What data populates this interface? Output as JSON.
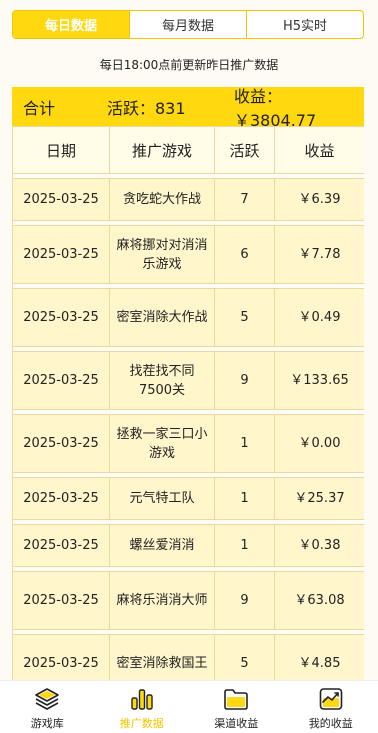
{
  "tabs": [
    {
      "label": "每日数据",
      "active": true
    },
    {
      "label": "每月数据",
      "active": false
    },
    {
      "label": "H5实时",
      "active": false
    }
  ],
  "notice": "每日18:00点前更新昨日推广数据",
  "summary": {
    "label": "合计",
    "active": "活跃：831",
    "income": "收益：￥3804.77"
  },
  "table": {
    "headers": [
      "日期",
      "推广游戏",
      "活跃",
      "收益"
    ],
    "rows": [
      {
        "date": "2025-03-25",
        "game": "贪吃蛇大作战",
        "active": "7",
        "income": "￥6.39"
      },
      {
        "date": "2025-03-25",
        "game": "麻将挪对对消消乐游戏",
        "active": "6",
        "income": "￥7.78"
      },
      {
        "date": "2025-03-25",
        "game": "密室消除大作战",
        "active": "5",
        "income": "￥0.49"
      },
      {
        "date": "2025-03-25",
        "game": "找茬找不同7500关",
        "active": "9",
        "income": "￥133.65"
      },
      {
        "date": "2025-03-25",
        "game": "拯救一家三口小游戏",
        "active": "1",
        "income": "￥0.00"
      },
      {
        "date": "2025-03-25",
        "game": "元气特工队",
        "active": "1",
        "income": "￥25.37"
      },
      {
        "date": "2025-03-25",
        "game": "螺丝爱消消",
        "active": "1",
        "income": "￥0.38"
      },
      {
        "date": "2025-03-25",
        "game": "麻将乐消消大师",
        "active": "9",
        "income": "￥63.08"
      },
      {
        "date": "2025-03-25",
        "game": "密室消除救国王",
        "active": "5",
        "income": "￥4.85"
      }
    ]
  },
  "nav": [
    {
      "label": "游戏库",
      "icon": "layers-icon",
      "active": false
    },
    {
      "label": "推广数据",
      "icon": "bar-chart-icon",
      "active": true
    },
    {
      "label": "渠道收益",
      "icon": "folder-icon",
      "active": false
    },
    {
      "label": "我的收益",
      "icon": "trend-chart-icon",
      "active": false
    }
  ],
  "colors": {
    "accent": "#ffd80f",
    "accent_text": "#f2c500",
    "row_bg": "#fff6cc"
  }
}
